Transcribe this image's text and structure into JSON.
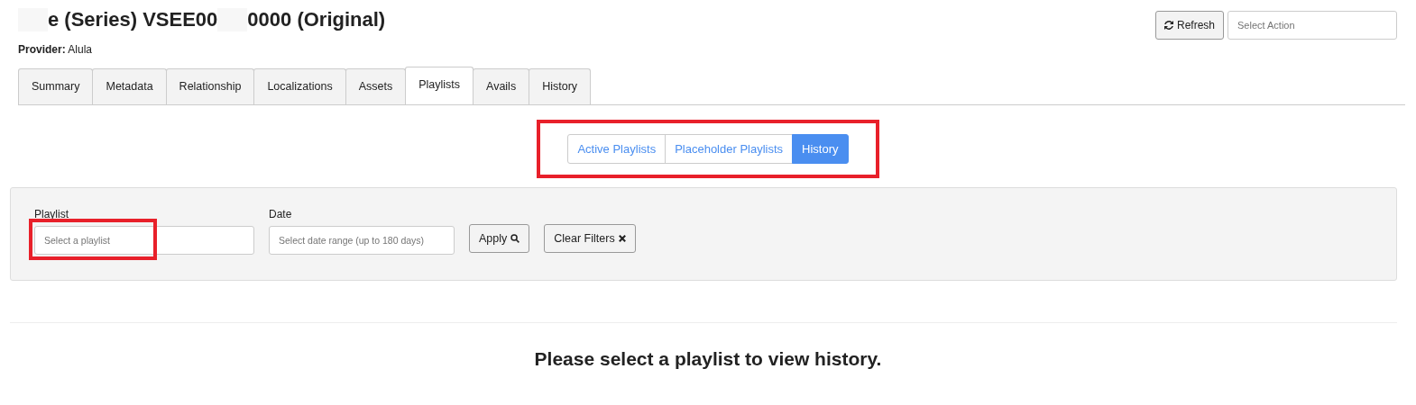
{
  "header": {
    "title_parts": [
      "e (Series) VSEE00",
      "0000 (Original)"
    ],
    "provider_label": "Provider:",
    "provider_value": "Alula"
  },
  "toolbar": {
    "refresh_button": "Refresh",
    "action_select": {
      "placeholder": "Select Action"
    }
  },
  "tabs": [
    {
      "label": "Summary",
      "selected": false
    },
    {
      "label": "Metadata",
      "selected": false
    },
    {
      "label": "Relationship",
      "selected": false
    },
    {
      "label": "Localizations",
      "selected": false
    },
    {
      "label": "Assets",
      "selected": false
    },
    {
      "label": "Playlists",
      "selected": true
    },
    {
      "label": "Avails",
      "selected": false
    },
    {
      "label": "History",
      "selected": false
    }
  ],
  "view_switch": {
    "highlighted": true,
    "options": [
      {
        "label": "Active Playlists",
        "selected": false
      },
      {
        "label": "Placeholder Playlists",
        "selected": false
      },
      {
        "label": "History",
        "selected": true
      }
    ]
  },
  "filters": {
    "playlist": {
      "label": "Playlist",
      "placeholder": "Select a playlist",
      "highlighted": true
    },
    "date": {
      "label": "Date",
      "placeholder": "Select date range (up to 180 days)"
    },
    "apply_button": "Apply",
    "clear_button": "Clear Filters"
  },
  "message": "Please select a playlist to view history."
}
